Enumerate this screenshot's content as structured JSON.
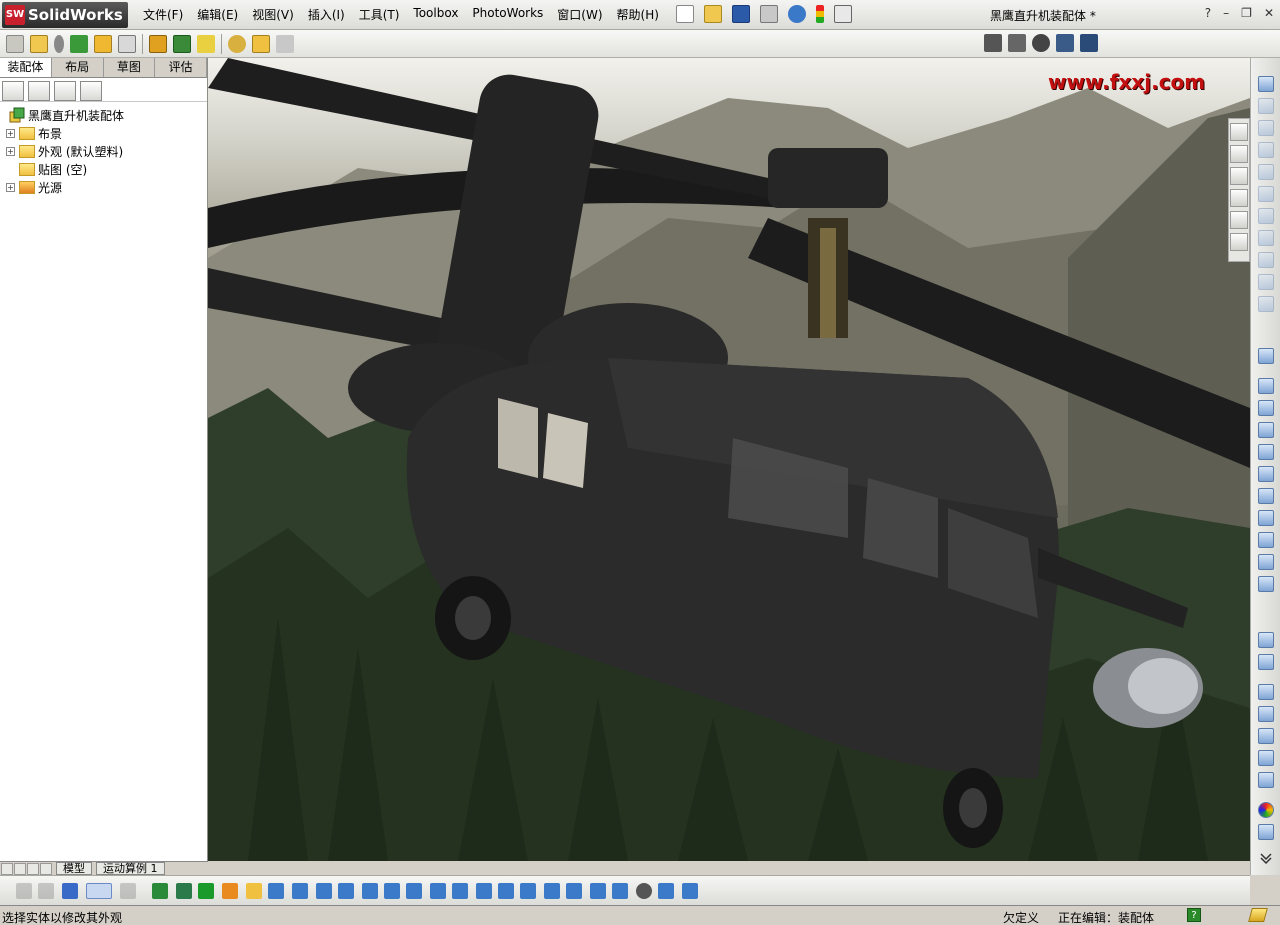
{
  "app": {
    "logo": "SolidWorks",
    "logo_badge": "SW"
  },
  "menu": [
    "文件(F)",
    "编辑(E)",
    "视图(V)",
    "插入(I)",
    "工具(T)",
    "Toolbox",
    "PhotoWorks",
    "窗口(W)",
    "帮助(H)"
  ],
  "document_title": "黑鹰直升机装配体 *",
  "window_controls": {
    "help": "?",
    "minimize": "–",
    "restore": "❐",
    "close": "✕"
  },
  "left_tabs": [
    "装配体",
    "布局",
    "草图",
    "评估"
  ],
  "tree": {
    "root": "黑鹰直升机装配体",
    "items": [
      {
        "label": "布景",
        "expandable": true
      },
      {
        "label": "外观 (默认塑料)",
        "expandable": true
      },
      {
        "label": "贴图 (空)",
        "expandable": false
      },
      {
        "label": "光源",
        "expandable": true
      }
    ]
  },
  "bottom_tabs": [
    "模型",
    "运动算例 1"
  ],
  "viewport": {
    "watermark": "www.fxxj.com"
  },
  "status": {
    "message": "选择实体以修改其外观",
    "definition": "欠定义",
    "editing": "正在编辑：装配体",
    "help_badge": "?"
  },
  "colors": {
    "logo_red": "#c8202c",
    "watermark": "#c21010",
    "helicopter": "#2b2b2b"
  }
}
